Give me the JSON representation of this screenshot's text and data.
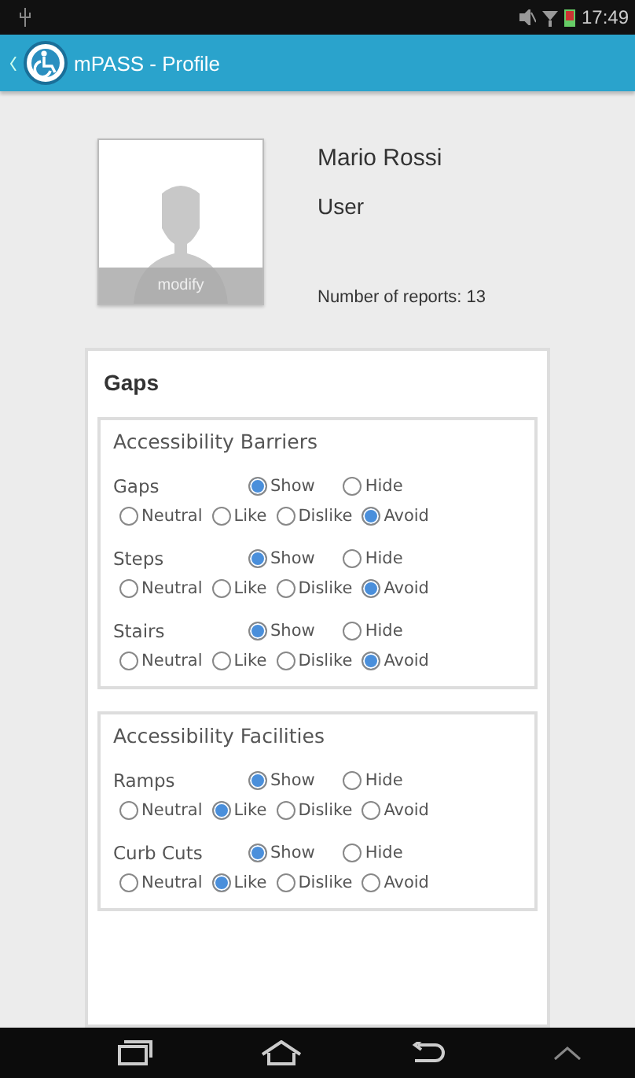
{
  "status_bar": {
    "time": "17:49"
  },
  "app_bar": {
    "title": "mPASS - Profile"
  },
  "profile": {
    "photo_button": "modify",
    "name": "Mario Rossi",
    "role": "User",
    "reports": "Number of reports: 13"
  },
  "section": {
    "title": "Gaps",
    "groups": [
      {
        "title": "Accessibility Barriers",
        "items": [
          {
            "label": "Gaps",
            "visibility": [
              {
                "label": "Show",
                "selected": true
              },
              {
                "label": "Hide",
                "selected": false
              }
            ],
            "preference": [
              {
                "label": "Neutral",
                "selected": false
              },
              {
                "label": "Like",
                "selected": false
              },
              {
                "label": "Dislike",
                "selected": false
              },
              {
                "label": "Avoid",
                "selected": true
              }
            ]
          },
          {
            "label": "Steps",
            "visibility": [
              {
                "label": "Show",
                "selected": true
              },
              {
                "label": "Hide",
                "selected": false
              }
            ],
            "preference": [
              {
                "label": "Neutral",
                "selected": false
              },
              {
                "label": "Like",
                "selected": false
              },
              {
                "label": "Dislike",
                "selected": false
              },
              {
                "label": "Avoid",
                "selected": true
              }
            ]
          },
          {
            "label": "Stairs",
            "visibility": [
              {
                "label": "Show",
                "selected": true
              },
              {
                "label": "Hide",
                "selected": false
              }
            ],
            "preference": [
              {
                "label": "Neutral",
                "selected": false
              },
              {
                "label": "Like",
                "selected": false
              },
              {
                "label": "Dislike",
                "selected": false
              },
              {
                "label": "Avoid",
                "selected": true
              }
            ]
          }
        ]
      },
      {
        "title": "Accessibility Facilities",
        "items": [
          {
            "label": "Ramps",
            "visibility": [
              {
                "label": "Show",
                "selected": true
              },
              {
                "label": "Hide",
                "selected": false
              }
            ],
            "preference": [
              {
                "label": "Neutral",
                "selected": false
              },
              {
                "label": "Like",
                "selected": true
              },
              {
                "label": "Dislike",
                "selected": false
              },
              {
                "label": "Avoid",
                "selected": false
              }
            ]
          },
          {
            "label": "Curb Cuts",
            "visibility": [
              {
                "label": "Show",
                "selected": true
              },
              {
                "label": "Hide",
                "selected": false
              }
            ],
            "preference": [
              {
                "label": "Neutral",
                "selected": false
              },
              {
                "label": "Like",
                "selected": true
              },
              {
                "label": "Dislike",
                "selected": false
              },
              {
                "label": "Avoid",
                "selected": false
              }
            ]
          }
        ]
      }
    ]
  }
}
